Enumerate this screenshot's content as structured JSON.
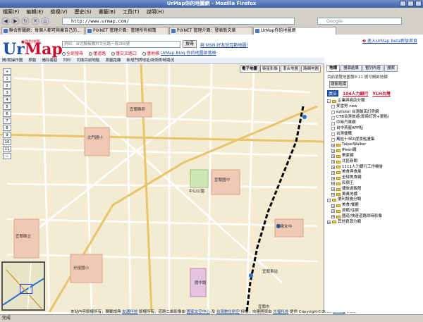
{
  "window": {
    "title": "UrMap你的地圖網 - Mozilla Firefox"
  },
  "menu": [
    "檔案(F)",
    "編輯(E)",
    "檢視(V)",
    "歷史(S)",
    "書籤(B)",
    "工具(T)",
    "說明(H)"
  ],
  "address": {
    "url": "http://www.urmap.com/"
  },
  "search": {
    "placeholder": "Google"
  },
  "tabs": [
    {
      "label": "聯合新聞網：每個人都可與擁自己的..."
    },
    {
      "label": "PIXNET 管理介面：管理所有相簿"
    },
    {
      "label": "PIXNET 管理介面：發表新文章"
    },
    {
      "label": "UrMap你的地圖網"
    }
  ],
  "site": {
    "logo_ur": "Ur",
    "logo_map": "Map",
    "logo_badge": "●你的地圖",
    "search_placeholder": "例如：台北縣板橋市文化路一段266號",
    "go_label": "搜尋",
    "promo": "與 MSN 好友玩互動地圖!",
    "radio_options": [
      "全部搜尋",
      "僅道路",
      "僅交叉路口",
      "僅地標"
    ],
    "blog_link": "UrMap Blog 你的地圖部落格",
    "new_version": "進入UrMap beta新版首頁"
  },
  "toolbar": [
    "開/關操作圖",
    "移動",
    "儲存連結",
    "列印",
    "切換目前地點",
    "測量距離",
    "新增門牌地址/新設即時路況"
  ],
  "map": {
    "zoom_levels": [
      "1",
      "2",
      "3",
      "4",
      "5",
      "6",
      "7",
      "8",
      "9",
      "10",
      "11"
    ],
    "map_types": [
      {
        "label": "電子地圖",
        "active": true
      },
      {
        "label": "衛星影像",
        "active": false
      },
      {
        "label": "混合地圖",
        "active": false
      },
      {
        "label": "路網地圖",
        "active": false
      }
    ],
    "labels": [
      {
        "text": "宜蘭縣府"
      },
      {
        "text": "中山公園"
      },
      {
        "text": "宜蘭國中"
      },
      {
        "text": "北門國小"
      },
      {
        "text": "光復國小"
      },
      {
        "text": "宜蘭縣立"
      },
      {
        "text": "蘭陽女中"
      },
      {
        "text": "宜蘭市"
      },
      {
        "text": "宜蘭車站"
      },
      {
        "text": "國中路"
      }
    ],
    "copyright_parts": [
      {
        "text": "本站內容版權所有，轉載請典",
        "link": false
      },
      {
        "text": "友通科技",
        "link": true
      },
      {
        "text": "版權所有。道路二維影像由",
        "link": false
      },
      {
        "text": "國家太空中心",
        "link": true
      },
      {
        "text": "及",
        "link": false
      },
      {
        "text": "台灣數位航空",
        "link": true
      },
      {
        "text": "授權，向量圖資由",
        "link": false
      },
      {
        "text": "大福科技",
        "link": true
      },
      {
        "text": "提供 Copyright©2005",
        "link": false
      },
      {
        "text": "UrMap",
        "link": true
      },
      {
        "text": "Inc.3",
        "link": false
      }
    ]
  },
  "sidebar": {
    "tabs": [
      {
        "label": "地標",
        "active": true
      },
      {
        "label": "搜尋結果",
        "active": false
      },
      {
        "label": "暫列內容",
        "active": false
      },
      {
        "label": "搜索",
        "active": false
      }
    ],
    "subtitle": "目前瀏覽地圖第8-11 層可開啟地標",
    "close_button": "關閉地標",
    "ad_label": "廣告",
    "ad_links": [
      "104人力銀行",
      "YLH台灣"
    ],
    "tree": [
      {
        "label": "企業與商店分類",
        "depth": 0,
        "type": "folder",
        "expand": "-"
      },
      {
        "label": "麥當勞 new",
        "depth": 1,
        "type": "leaf"
      },
      {
        "label": "ezhotel 台灣飯店訂房網",
        "depth": 1,
        "type": "leaf"
      },
      {
        "label": "CTB台灣旅遊(即時訂房+景點)",
        "depth": 1,
        "type": "leaf"
      },
      {
        "label": "中時汽車網",
        "depth": 1,
        "type": "leaf"
      },
      {
        "label": "台中燕屋APP點",
        "depth": 1,
        "type": "leaf"
      },
      {
        "label": "台灣優購",
        "depth": 1,
        "type": "leaf"
      },
      {
        "label": "萬娃十360度景點畫集",
        "depth": 1,
        "type": "leaf"
      },
      {
        "label": "TaipeiWalker",
        "depth": 1,
        "type": "folder",
        "expand": "+"
      },
      {
        "label": "iPeen網",
        "depth": 1,
        "type": "folder",
        "expand": "+"
      },
      {
        "label": "樂家網",
        "depth": 1,
        "type": "folder",
        "expand": "+"
      },
      {
        "label": "北區新聞",
        "depth": 1,
        "type": "folder",
        "expand": "+"
      },
      {
        "label": "1111人力銀行工作機會",
        "depth": 1,
        "type": "folder",
        "expand": "+"
      },
      {
        "label": "美食與食風",
        "depth": 1,
        "type": "folder",
        "expand": "+"
      },
      {
        "label": "全球美食網",
        "depth": 1,
        "type": "folder",
        "expand": "+"
      },
      {
        "label": "民宿王",
        "depth": 1,
        "type": "folder",
        "expand": "+"
      },
      {
        "label": "捷旅遊飯館",
        "depth": 1,
        "type": "folder",
        "expand": "+"
      },
      {
        "label": "萬萬地標",
        "depth": 1,
        "type": "folder",
        "expand": "+"
      },
      {
        "label": "便利設施分類",
        "depth": 0,
        "type": "folder",
        "expand": "-"
      },
      {
        "label": "美食/餐廳",
        "depth": 1,
        "type": "folder",
        "expand": "+"
      },
      {
        "label": "旅館/住宿",
        "depth": 1,
        "type": "folder",
        "expand": "+"
      },
      {
        "label": "國道/快速道路即時影像",
        "depth": 1,
        "type": "folder",
        "expand": "+"
      },
      {
        "label": "其他資源分類",
        "depth": 0,
        "type": "folder",
        "expand": "+"
      }
    ]
  },
  "status": {
    "text": "完成"
  }
}
